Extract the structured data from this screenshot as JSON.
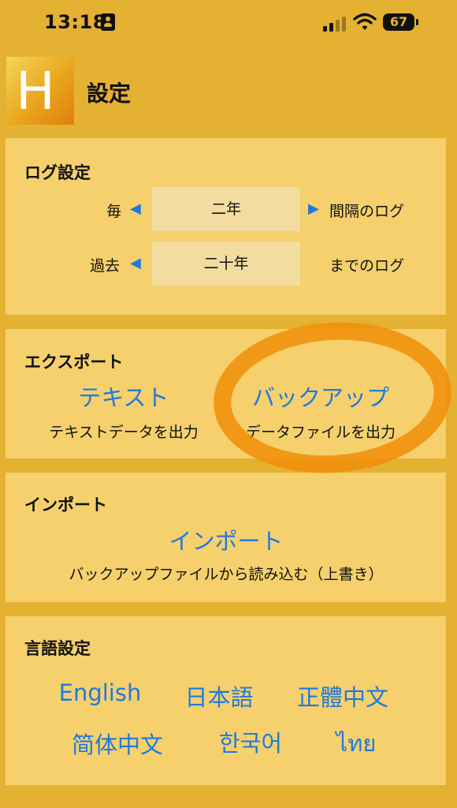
{
  "status_bar": {
    "time": "13:18",
    "battery": "67",
    "icons": [
      "id-badge-icon",
      "signal-icon",
      "wifi-icon",
      "battery-icon"
    ]
  },
  "header": {
    "logo_letter": "H",
    "title": "設定"
  },
  "log_settings": {
    "title": "ログ設定",
    "interval_prefix": "毎",
    "interval_value": "二年",
    "interval_suffix": "間隔のログ",
    "period_prefix": "過去",
    "period_value": "二十年",
    "period_suffix": "までのログ"
  },
  "export": {
    "title": "エクスポート",
    "text_label": "テキスト",
    "text_desc": "テキストデータを出力",
    "backup_label": "バックアップ",
    "backup_desc": "データファイルを出力"
  },
  "import": {
    "title": "インポート",
    "import_label": "インポート",
    "import_desc": "バックアップファイルから読み込む（上書き）"
  },
  "language": {
    "title": "言語設定",
    "options": [
      "English",
      "日本語",
      "正體中文",
      "简体中文",
      "한국어",
      "ไทย"
    ]
  },
  "colors": {
    "background": "#e5b132",
    "panel": "#f5d06c",
    "value_box": "#f3dca0",
    "link": "#1e7ae0",
    "highlight": "#f0900a"
  }
}
